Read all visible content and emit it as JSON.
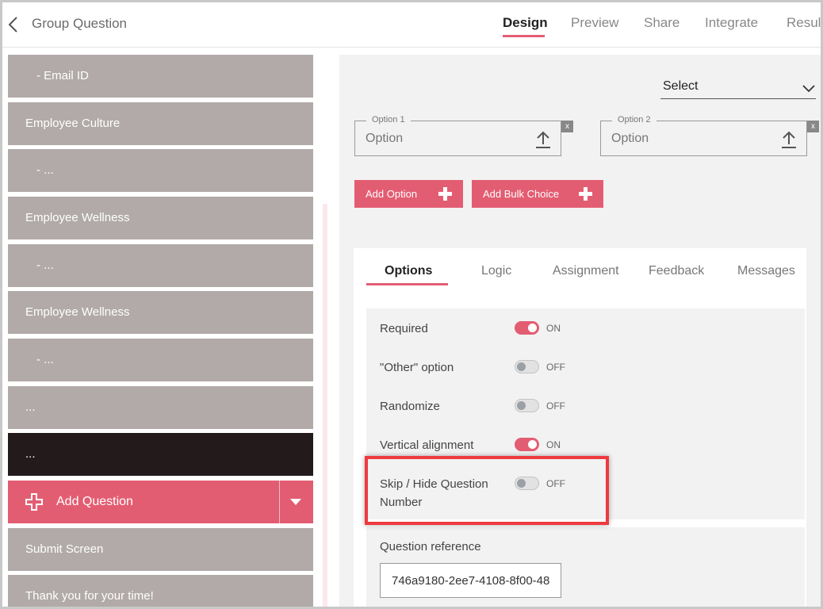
{
  "header": {
    "title": "Group Question",
    "tabs": [
      {
        "label": "Design"
      },
      {
        "label": "Preview"
      },
      {
        "label": "Share"
      },
      {
        "label": "Integrate"
      },
      {
        "label": "Result"
      }
    ]
  },
  "sidebar": {
    "items": [
      {
        "label": "-  Email ID"
      },
      {
        "label": "Employee Culture"
      },
      {
        "label": "-  ..."
      },
      {
        "label": "Employee Wellness"
      },
      {
        "label": "-  ..."
      },
      {
        "label": "Employee Wellness"
      },
      {
        "label": "-  ..."
      },
      {
        "label": "..."
      },
      {
        "label": "..."
      }
    ],
    "add_question_label": "Add Question",
    "submit_screen_label": "Submit Screen",
    "thank_you_label": "Thank you for your time!"
  },
  "editor": {
    "select_label": "Select",
    "options": [
      {
        "legend": "Option 1",
        "placeholder": "Option",
        "close": "x"
      },
      {
        "legend": "Option 2",
        "placeholder": "Option",
        "close": "x"
      }
    ],
    "add_option_label": "Add Option",
    "add_bulk_choice_label": "Add Bulk Choice"
  },
  "settings": {
    "tabs": [
      {
        "label": "Options"
      },
      {
        "label": "Logic"
      },
      {
        "label": "Assignment"
      },
      {
        "label": "Feedback"
      },
      {
        "label": "Messages"
      }
    ],
    "toggles": [
      {
        "label": "Required",
        "state": "ON"
      },
      {
        "label": "\"Other\" option",
        "state": "OFF"
      },
      {
        "label": "Randomize",
        "state": "OFF"
      },
      {
        "label": "Vertical alignment",
        "state": "ON"
      },
      {
        "label_line1": "Skip / Hide Question",
        "label_line2": "Number",
        "state": "OFF"
      }
    ],
    "question_reference_label": "Question reference",
    "question_reference_value": "746a9180-2ee7-4108-8f00-48"
  },
  "colors": {
    "accent": "#e35d72",
    "sidebar_item": "#b1aaa8",
    "sidebar_active": "#231a1c",
    "highlight": "#ee3a3f"
  }
}
